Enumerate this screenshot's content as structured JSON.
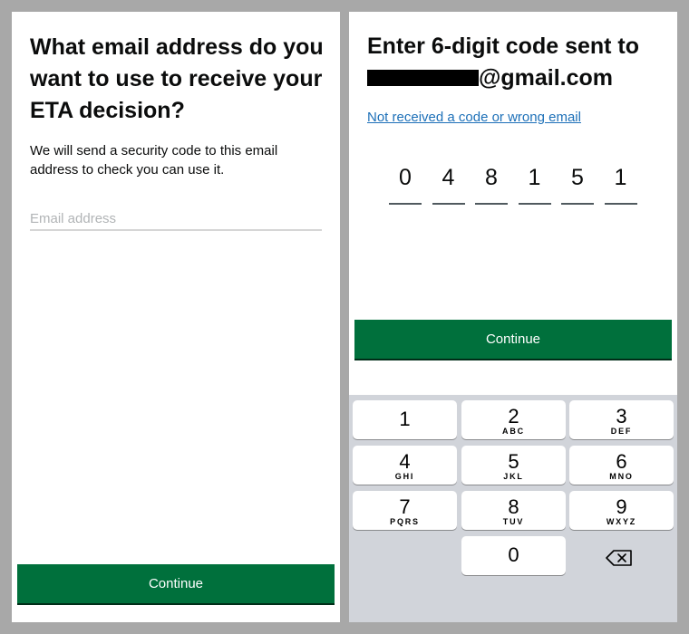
{
  "left_screen": {
    "heading": "What email address do you want to use to receive your ETA decision?",
    "body": "We will send a security code to this email address to check you can use it.",
    "email_placeholder": "Email address",
    "continue_label": "Continue"
  },
  "right_screen": {
    "heading_line1": "Enter 6-digit code sent to",
    "email_suffix": "@gmail.com",
    "resend_link": "Not received a code or wrong email",
    "code_digits": [
      "0",
      "4",
      "8",
      "1",
      "5",
      "1"
    ],
    "continue_label": "Continue",
    "keypad": [
      {
        "digit": "1",
        "letters": ""
      },
      {
        "digit": "2",
        "letters": "ABC"
      },
      {
        "digit": "3",
        "letters": "DEF"
      },
      {
        "digit": "4",
        "letters": "GHI"
      },
      {
        "digit": "5",
        "letters": "JKL"
      },
      {
        "digit": "6",
        "letters": "MNO"
      },
      {
        "digit": "7",
        "letters": "PQRS"
      },
      {
        "digit": "8",
        "letters": "TUV"
      },
      {
        "digit": "9",
        "letters": "WXYZ"
      },
      {
        "digit": "0",
        "letters": ""
      }
    ],
    "backspace_icon": "backspace-icon"
  },
  "colors": {
    "primary_button": "#00703c",
    "link": "#1d70b8",
    "text": "#0b0c0c",
    "keyboard_bg": "#d1d4da",
    "frame": "#a8a8a8"
  }
}
